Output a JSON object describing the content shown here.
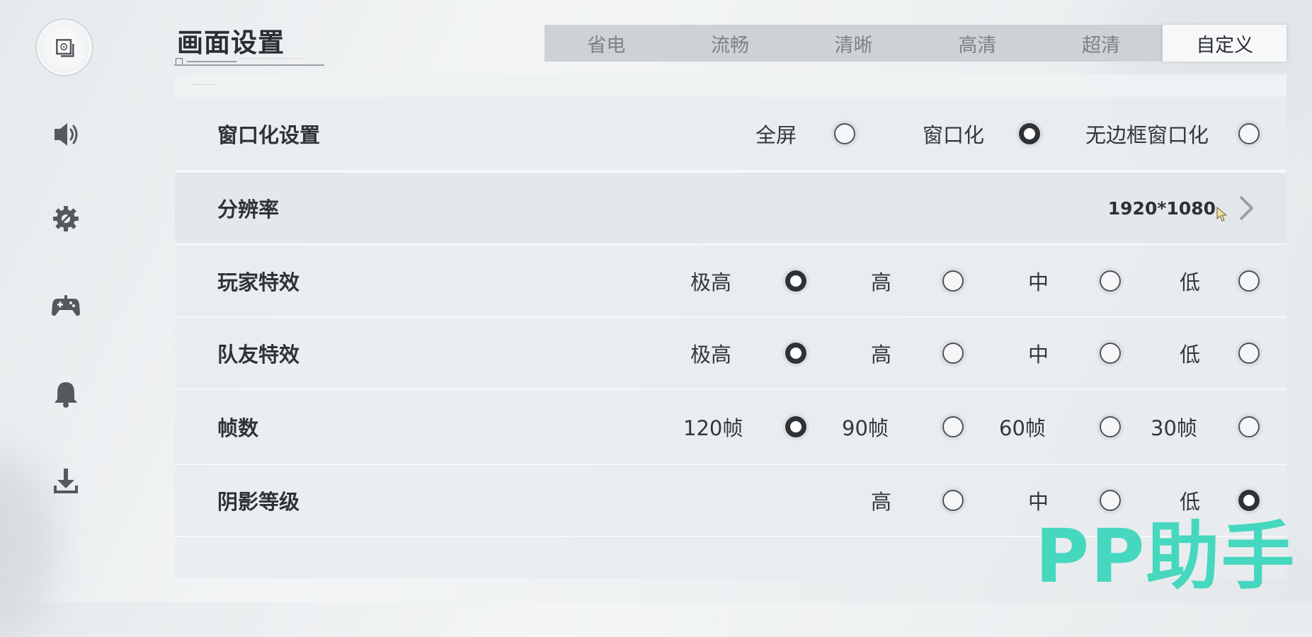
{
  "page": {
    "title": "画面设置"
  },
  "sidebar": {
    "items": [
      {
        "name": "display-settings",
        "icon": "monitor-icon"
      },
      {
        "name": "sound-settings",
        "icon": "speaker-icon"
      },
      {
        "name": "general-settings",
        "icon": "gear-icon"
      },
      {
        "name": "controls-settings",
        "icon": "gamepad-icon"
      },
      {
        "name": "notification-settings",
        "icon": "bell-icon"
      },
      {
        "name": "download-settings",
        "icon": "download-icon"
      }
    ],
    "active_index": 0
  },
  "quality_tabs": {
    "items": [
      "省电",
      "流畅",
      "清晰",
      "高清",
      "超清",
      "自定义"
    ],
    "selected": "自定义"
  },
  "settings": {
    "window_mode": {
      "label": "窗口化设置",
      "options": [
        "全屏",
        "窗口化",
        "无边框窗口化"
      ],
      "selected": "窗口化"
    },
    "resolution": {
      "label": "分辨率",
      "value": "1920*1080"
    },
    "player_effects": {
      "label": "玩家特效",
      "options": [
        "极高",
        "高",
        "中",
        "低"
      ],
      "selected": "极高"
    },
    "teammate_effects": {
      "label": "队友特效",
      "options": [
        "极高",
        "高",
        "中",
        "低"
      ],
      "selected": "极高"
    },
    "frame_rate": {
      "label": "帧数",
      "options": [
        "120帧",
        "90帧",
        "60帧",
        "30帧"
      ],
      "selected": "120帧"
    },
    "shadow_level": {
      "label": "阴影等级",
      "options": [
        "高",
        "中",
        "低"
      ],
      "selected": "低"
    }
  },
  "watermark": {
    "text": "PP助手"
  },
  "colors": {
    "accent_watermark": "#3ed6bd",
    "tab_bar": "#cdd2d6",
    "tab_active": "#f7f8f9",
    "radio_checked": "#2f3337"
  }
}
